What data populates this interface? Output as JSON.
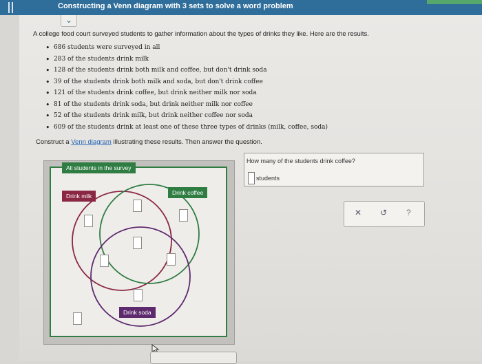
{
  "header": {
    "title": "Constructing a Venn diagram with 3 sets to solve a word problem"
  },
  "problem": {
    "intro": "A college food court surveyed students to gather information about the types of drinks they like. Here are the results.",
    "facts": [
      "686 students were surveyed in all",
      "283 of the students drink milk",
      "128 of the students drink both milk and coffee, but don't drink soda",
      "39 of the students drink both milk and soda, but don't drink coffee",
      "121 of the students drink coffee, but drink neither milk nor soda",
      "81 of the students drink soda, but drink neither milk nor coffee",
      "52 of the students drink milk, but drink neither coffee nor soda",
      "609 of the students drink at least one of these three types of drinks (milk, coffee, soda)"
    ],
    "instruction_before": "Construct a ",
    "instruction_link": "Venn diagram",
    "instruction_after": " illustrating these results. Then answer the question."
  },
  "venn": {
    "universe_label": "All students in the survey",
    "set_a_label": "Drink milk",
    "set_b_label": "Drink coffee",
    "set_c_label": "Drink soda",
    "colors": {
      "milk": "#8a2844",
      "coffee": "#2f7d43",
      "soda": "#5e2a6e",
      "universe": "#2f7d43"
    }
  },
  "question": {
    "text": "How many of the students drink coffee?",
    "unit": "students",
    "answer": ""
  },
  "toolbar": {
    "clear_icon": "x-icon",
    "undo_icon": "undo-icon",
    "help_icon": "question-icon"
  }
}
